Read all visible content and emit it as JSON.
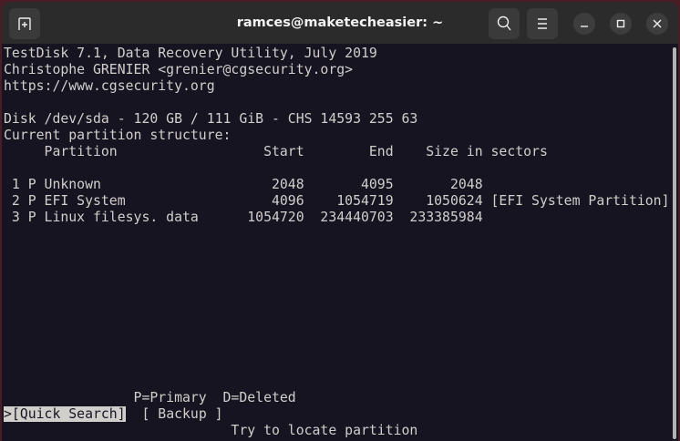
{
  "window": {
    "title": "ramces@maketecheasier: ~"
  },
  "icons": {
    "new_tab": "new-tab-icon",
    "search": "search-icon",
    "menu": "hamburger-menu-icon",
    "minimize": "minimize-icon",
    "maximize": "maximize-icon",
    "close": "close-icon"
  },
  "terminal": {
    "header": [
      "TestDisk 7.1, Data Recovery Utility, July 2019",
      "Christophe GRENIER <grenier@cgsecurity.org>",
      "https://www.cgsecurity.org"
    ],
    "disk": "Disk /dev/sda - 120 GB / 111 GiB - CHS 14593 255 63",
    "structure_label": "Current partition structure:",
    "columns": "     Partition                  Start        End    Size in sectors",
    "partitions": [
      " 1 P Unknown                     2048       4095       2048",
      " 2 P EFI System                  4096    1054719    1050624 [EFI System Partition]",
      " 3 P Linux filesys. data      1054720  234440703  233385984"
    ],
    "legend": "                P=Primary  D=Deleted",
    "menu": {
      "quick_search": ">[Quick Search]",
      "backup": "[ Backup ]"
    },
    "hint": "                            Try to locate partition"
  }
}
